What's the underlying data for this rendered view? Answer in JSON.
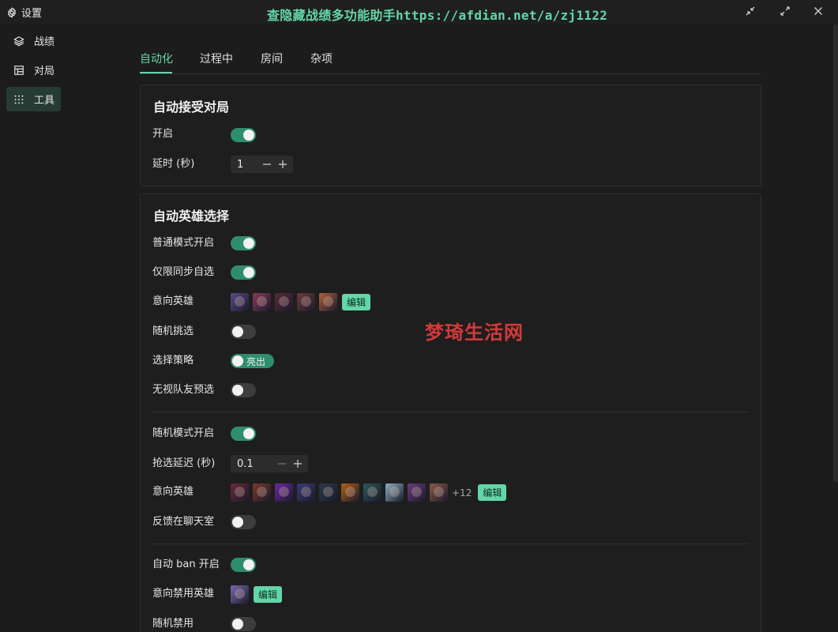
{
  "titlebar": {
    "settings_label": "设置",
    "watermark": "查隐藏战绩多功能助手https://afdian.net/a/zj1122",
    "icons": [
      "gear-icon",
      "collapse-icon",
      "expand-icon",
      "close-icon"
    ]
  },
  "sidebar": {
    "items": [
      {
        "label": "战绩",
        "icon": "layers-icon",
        "active": false
      },
      {
        "label": "对局",
        "icon": "board-icon",
        "active": false
      },
      {
        "label": "工具",
        "icon": "grid-dots-icon",
        "active": true
      }
    ]
  },
  "tabs": [
    {
      "label": "自动化",
      "active": true
    },
    {
      "label": "过程中",
      "active": false
    },
    {
      "label": "房间",
      "active": false
    },
    {
      "label": "杂项",
      "active": false
    }
  ],
  "auto_accept": {
    "title": "自动接受对局",
    "enable_label": "开启",
    "enable_on": true,
    "delay_label": "延时 (秒)",
    "delay_value": "1"
  },
  "auto_pick": {
    "title": "自动英雄选择",
    "normal_label": "普通模式开启",
    "normal_on": true,
    "sync_label": "仅限同步自选",
    "sync_on": true,
    "intent_label": "意向英雄",
    "intent_edit": "编辑",
    "random_label": "随机挑选",
    "random_on": false,
    "strategy_label": "选择策略",
    "strategy_value": "亮出",
    "ignore_label": "无视队友预选",
    "ignore_on": false,
    "aram_label": "随机模式开启",
    "aram_on": true,
    "grab_delay_label": "抢选延迟 (秒)",
    "grab_delay_value": "0.1",
    "aram_intent_label": "意向英雄",
    "aram_more": "+12",
    "aram_edit": "编辑",
    "feedback_label": "反馈在聊天室",
    "feedback_on": false,
    "ban_label": "自动 ban 开启",
    "ban_on": true,
    "ban_intent_label": "意向禁用英雄",
    "ban_edit": "编辑",
    "random_ban_label": "随机禁用",
    "random_ban_on": false
  },
  "overlay_watermark": "梦琦生活网",
  "colors": {
    "accent": "#63d6a8",
    "switch_on": "#2e8e6b",
    "switch_off": "#3d3d3d",
    "background": "#1c1c1c",
    "watermark_red": "#d23a3a"
  },
  "champion_colors": {
    "intent": [
      "#5a4a8a",
      "#8a3a5a",
      "#5a2a3a",
      "#6a3a3a",
      "#b0603a"
    ],
    "aram": [
      "#6a2a3a",
      "#7a3a2a",
      "#6a2aa0",
      "#3a3a7a",
      "#2a3a4a",
      "#b0601a",
      "#2a5a5a",
      "#8ab0c0",
      "#6a3a7a",
      "#8a5a4a"
    ],
    "ban": [
      "#7a6ab0"
    ]
  }
}
